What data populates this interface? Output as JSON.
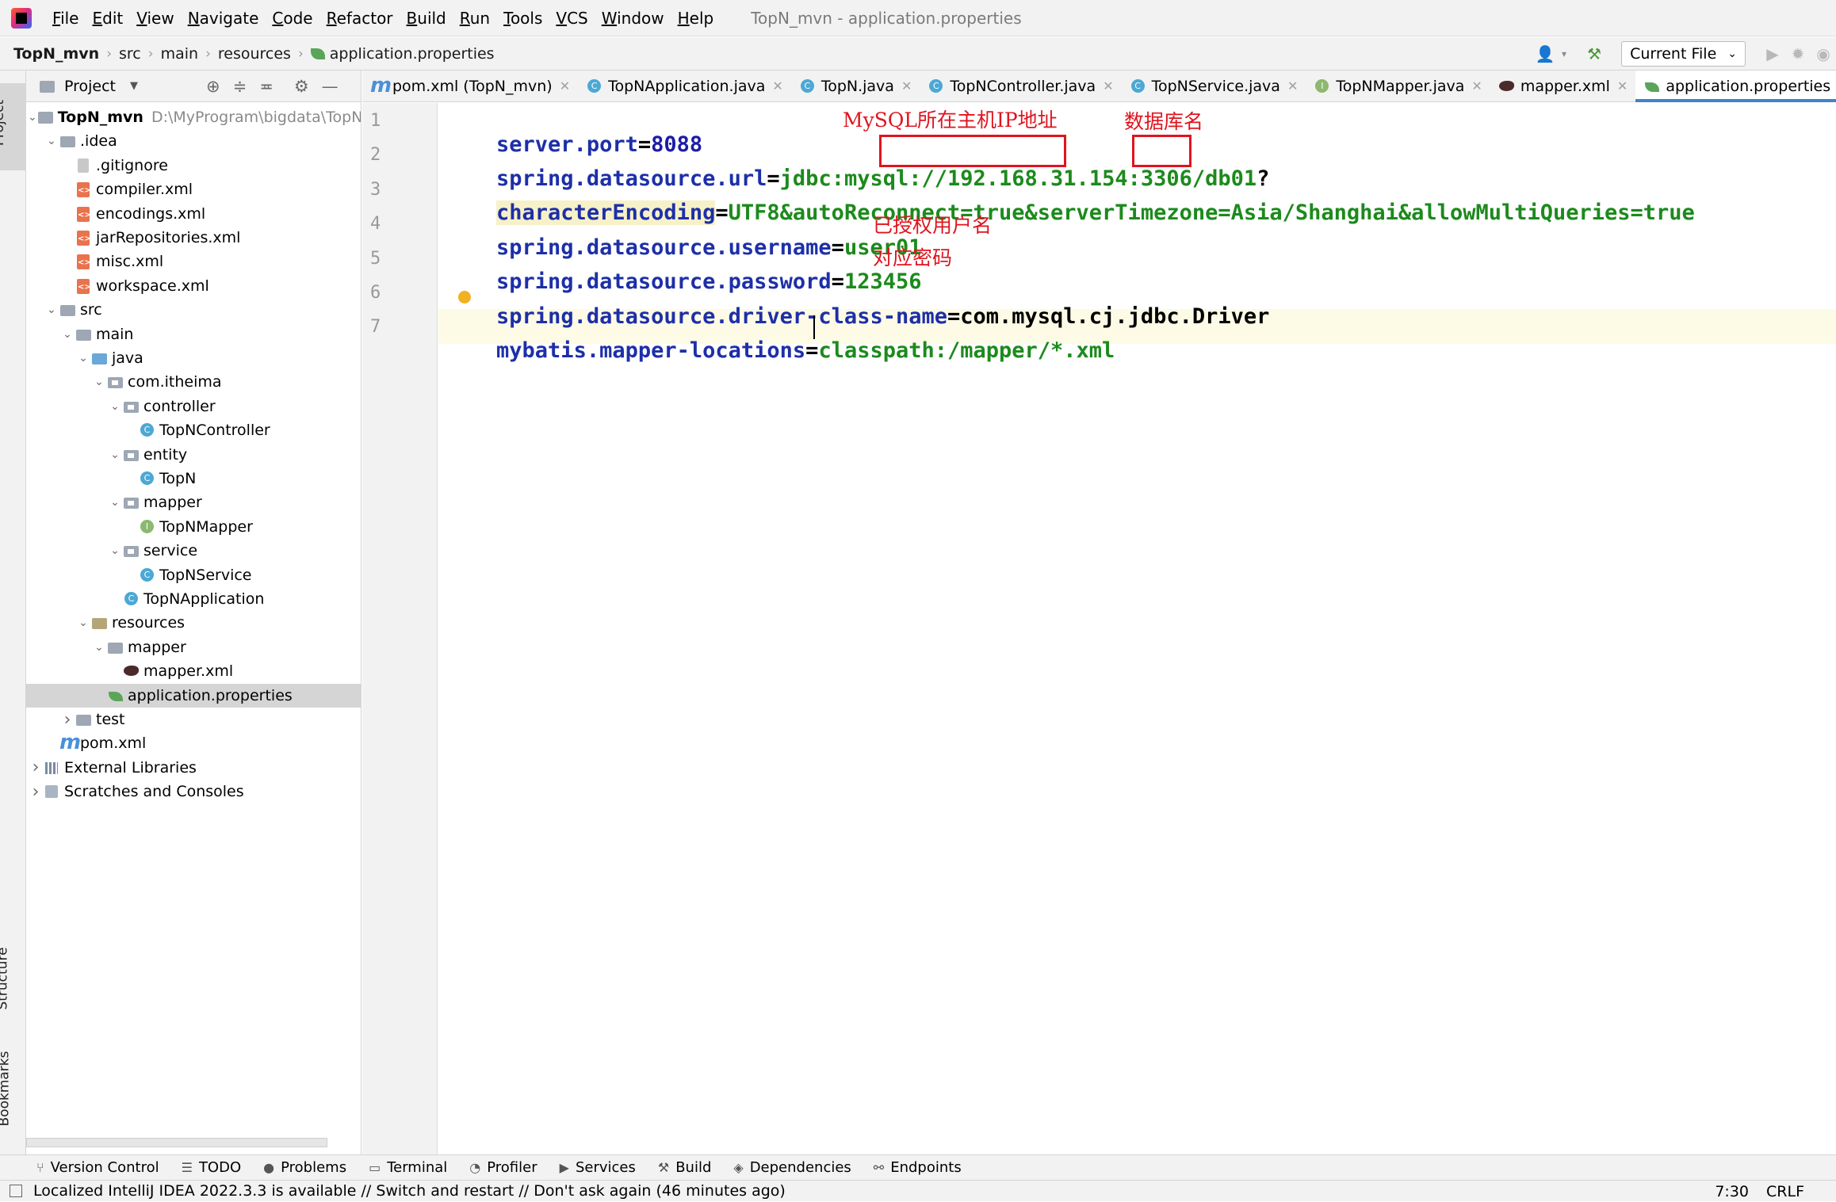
{
  "menu": {
    "items": [
      "File",
      "Edit",
      "View",
      "Navigate",
      "Code",
      "Refactor",
      "Build",
      "Run",
      "Tools",
      "VCS",
      "Window",
      "Help"
    ],
    "window_title": "TopN_mvn - application.properties"
  },
  "breadcrumb": [
    "TopN_mvn",
    "src",
    "main",
    "resources",
    "application.properties"
  ],
  "toolbar": {
    "run_config": "Current File"
  },
  "left_strip": {
    "project": "Project",
    "structure": "Structure",
    "bookmarks": "Bookmarks"
  },
  "project_panel": {
    "title": "Project"
  },
  "tree": [
    {
      "label": "TopN_mvn",
      "path": "D:\\MyProgram\\bigdata\\TopN",
      "depth": 0,
      "icon": "project-icon",
      "chev": "v",
      "bold": true
    },
    {
      "label": ".idea",
      "depth": 1,
      "icon": "folder-icon",
      "chev": "v"
    },
    {
      "label": ".gitignore",
      "depth": 2,
      "icon": "gitignore-icon"
    },
    {
      "label": "compiler.xml",
      "depth": 2,
      "icon": "xml-icon"
    },
    {
      "label": "encodings.xml",
      "depth": 2,
      "icon": "xml-icon"
    },
    {
      "label": "jarRepositories.xml",
      "depth": 2,
      "icon": "xml-icon"
    },
    {
      "label": "misc.xml",
      "depth": 2,
      "icon": "xml-icon"
    },
    {
      "label": "workspace.xml",
      "depth": 2,
      "icon": "xml-icon"
    },
    {
      "label": "src",
      "depth": 1,
      "icon": "folder-icon",
      "chev": "v"
    },
    {
      "label": "main",
      "depth": 2,
      "icon": "folder-icon",
      "chev": "v"
    },
    {
      "label": "java",
      "depth": 3,
      "icon": "source-folder-icon",
      "chev": "v"
    },
    {
      "label": "com.itheima",
      "depth": 4,
      "icon": "package-icon",
      "chev": "v"
    },
    {
      "label": "controller",
      "depth": 5,
      "icon": "package-icon",
      "chev": "v"
    },
    {
      "label": "TopNController",
      "depth": 6,
      "icon": "class-icon"
    },
    {
      "label": "entity",
      "depth": 5,
      "icon": "package-icon",
      "chev": "v"
    },
    {
      "label": "TopN",
      "depth": 6,
      "icon": "class-icon"
    },
    {
      "label": "mapper",
      "depth": 5,
      "icon": "package-icon",
      "chev": "v"
    },
    {
      "label": "TopNMapper",
      "depth": 6,
      "icon": "interface-icon"
    },
    {
      "label": "service",
      "depth": 5,
      "icon": "package-icon",
      "chev": "v"
    },
    {
      "label": "TopNService",
      "depth": 6,
      "icon": "class-icon"
    },
    {
      "label": "TopNApplication",
      "depth": 5,
      "icon": "spring-class-icon"
    },
    {
      "label": "resources",
      "depth": 3,
      "icon": "resources-folder-icon",
      "chev": "v"
    },
    {
      "label": "mapper",
      "depth": 4,
      "icon": "folder-icon",
      "chev": "v"
    },
    {
      "label": "mapper.xml",
      "depth": 5,
      "icon": "mybatis-icon"
    },
    {
      "label": "application.properties",
      "depth": 4,
      "icon": "spring-properties-icon",
      "selected": true
    },
    {
      "label": "test",
      "depth": 2,
      "icon": "folder-icon",
      "chev": ">"
    },
    {
      "label": "pom.xml",
      "depth": 1,
      "icon": "maven-icon"
    },
    {
      "label": "External Libraries",
      "depth": 0,
      "icon": "libraries-icon",
      "chev": ">"
    },
    {
      "label": "Scratches and Consoles",
      "depth": 0,
      "icon": "scratches-icon",
      "chev": ">"
    }
  ],
  "tabs": [
    {
      "label": "pom.xml (TopN_mvn)",
      "icon": "maven-icon"
    },
    {
      "label": "TopNApplication.java",
      "icon": "spring-class-icon"
    },
    {
      "label": "TopN.java",
      "icon": "class-icon"
    },
    {
      "label": "TopNController.java",
      "icon": "class-icon"
    },
    {
      "label": "TopNService.java",
      "icon": "class-icon"
    },
    {
      "label": "TopNMapper.java",
      "icon": "interface-icon"
    },
    {
      "label": "mapper.xml",
      "icon": "mybatis-icon"
    },
    {
      "label": "application.properties",
      "icon": "spring-properties-icon",
      "active": true
    }
  ],
  "editor": {
    "line_numbers": [
      "1",
      "2",
      "3",
      "4",
      "5",
      "6",
      "7"
    ],
    "lines": {
      "l1": {
        "key": "server.port",
        "eq": "=",
        "val": "8088"
      },
      "l2": {
        "key": "spring.datasource.url",
        "eq": "=",
        "v1": "jdbc:mysql:/",
        "ip": "/192.168.31.154",
        "port": ":3306",
        "db": "/db01",
        "q": "?"
      },
      "l3": {
        "key": "characterEncoding",
        "eq": "=",
        "val": "UTF8&autoReconnect=true&serverTimezone=Asia/Shanghai&allowMultiQueries=true"
      },
      "l4": {
        "key": "spring.datasource.username",
        "eq": "=",
        "val": "user01"
      },
      "l5": {
        "key": "spring.datasource.password",
        "eq": "=",
        "val": "123456"
      },
      "l6": {
        "key1": "s",
        "key2": "pring.datasource.driver-class-name",
        "eq": "=",
        "val": "com.mysql.cj.jdbc.Driver"
      },
      "l7": {
        "key": "mybatis.mapper-locations",
        "eq": "=",
        "val": "classpath:/mapper/*.xml"
      }
    },
    "annotations": {
      "host_ip": "MySQL所在主机IP地址",
      "db_name": "数据库名",
      "user": "已授权用户名",
      "password": "对应密码"
    }
  },
  "tool_windows": [
    {
      "label": "Version Control",
      "icon": "vcs-icon"
    },
    {
      "label": "TODO",
      "icon": "todo-icon"
    },
    {
      "label": "Problems",
      "icon": "problems-icon"
    },
    {
      "label": "Terminal",
      "icon": "terminal-icon"
    },
    {
      "label": "Profiler",
      "icon": "profiler-icon"
    },
    {
      "label": "Services",
      "icon": "services-icon"
    },
    {
      "label": "Build",
      "icon": "build-icon"
    },
    {
      "label": "Dependencies",
      "icon": "dependencies-icon"
    },
    {
      "label": "Endpoints",
      "icon": "endpoints-icon"
    }
  ],
  "status": {
    "message": "Localized IntelliJ IDEA 2022.3.3 is available // Switch and restart // Don't ask again (46 minutes ago)",
    "position": "7:30",
    "line_sep": "CRLF"
  }
}
